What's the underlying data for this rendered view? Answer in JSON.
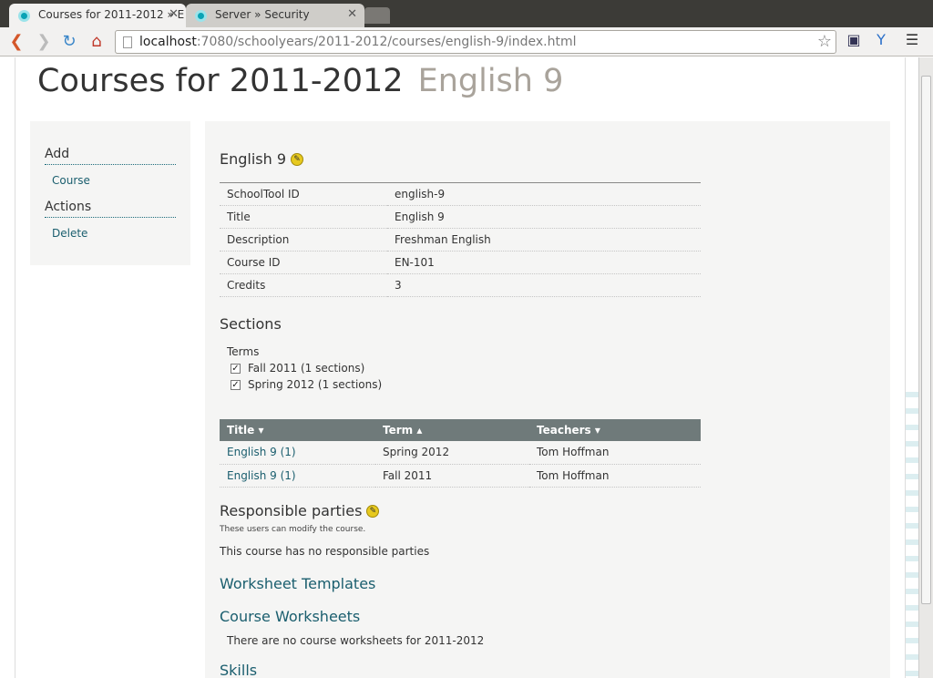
{
  "browser": {
    "tabs": [
      {
        "title": "Courses for 2011-2012 » E",
        "active": true
      },
      {
        "title": "Server » Security",
        "active": false
      }
    ],
    "url_host": "localhost",
    "url_rest": ":7080/schoolyears/2011-2012/courses/english-9/index.html"
  },
  "page": {
    "title": "Courses for 2011-2012",
    "subtitle": "English 9"
  },
  "sidebar": {
    "add_heading": "Add",
    "add_course": "Course",
    "actions_heading": "Actions",
    "delete": "Delete"
  },
  "course": {
    "heading": "English 9",
    "fields": [
      {
        "label": "SchoolTool ID",
        "value": "english-9"
      },
      {
        "label": "Title",
        "value": "English 9"
      },
      {
        "label": "Description",
        "value": "Freshman English"
      },
      {
        "label": "Course ID",
        "value": "EN-101"
      },
      {
        "label": "Credits",
        "value": "3"
      }
    ]
  },
  "sections": {
    "heading": "Sections",
    "terms_label": "Terms",
    "terms": [
      {
        "label": "Fall 2011 (1 sections)",
        "checked": true
      },
      {
        "label": "Spring 2012 (1 sections)",
        "checked": true
      }
    ],
    "columns": [
      "Title ▾",
      "Term ▴",
      "Teachers ▾"
    ],
    "rows": [
      {
        "title": "English 9 (1)",
        "term": "Spring 2012",
        "teachers": "Tom Hoffman"
      },
      {
        "title": "English 9 (1)",
        "term": "Fall 2011",
        "teachers": "Tom Hoffman"
      }
    ]
  },
  "responsible": {
    "heading": "Responsible parties",
    "note": "These users can modify the course.",
    "message": "This course has no responsible parties"
  },
  "worksheet_templates": {
    "heading": "Worksheet Templates"
  },
  "course_worksheets": {
    "heading": "Course Worksheets",
    "message": "There are no course worksheets for 2011-2012"
  },
  "skills": {
    "heading": "Skills"
  },
  "colors": {
    "accent": "#1a5e6e",
    "table_header": "#6f7a7a"
  }
}
